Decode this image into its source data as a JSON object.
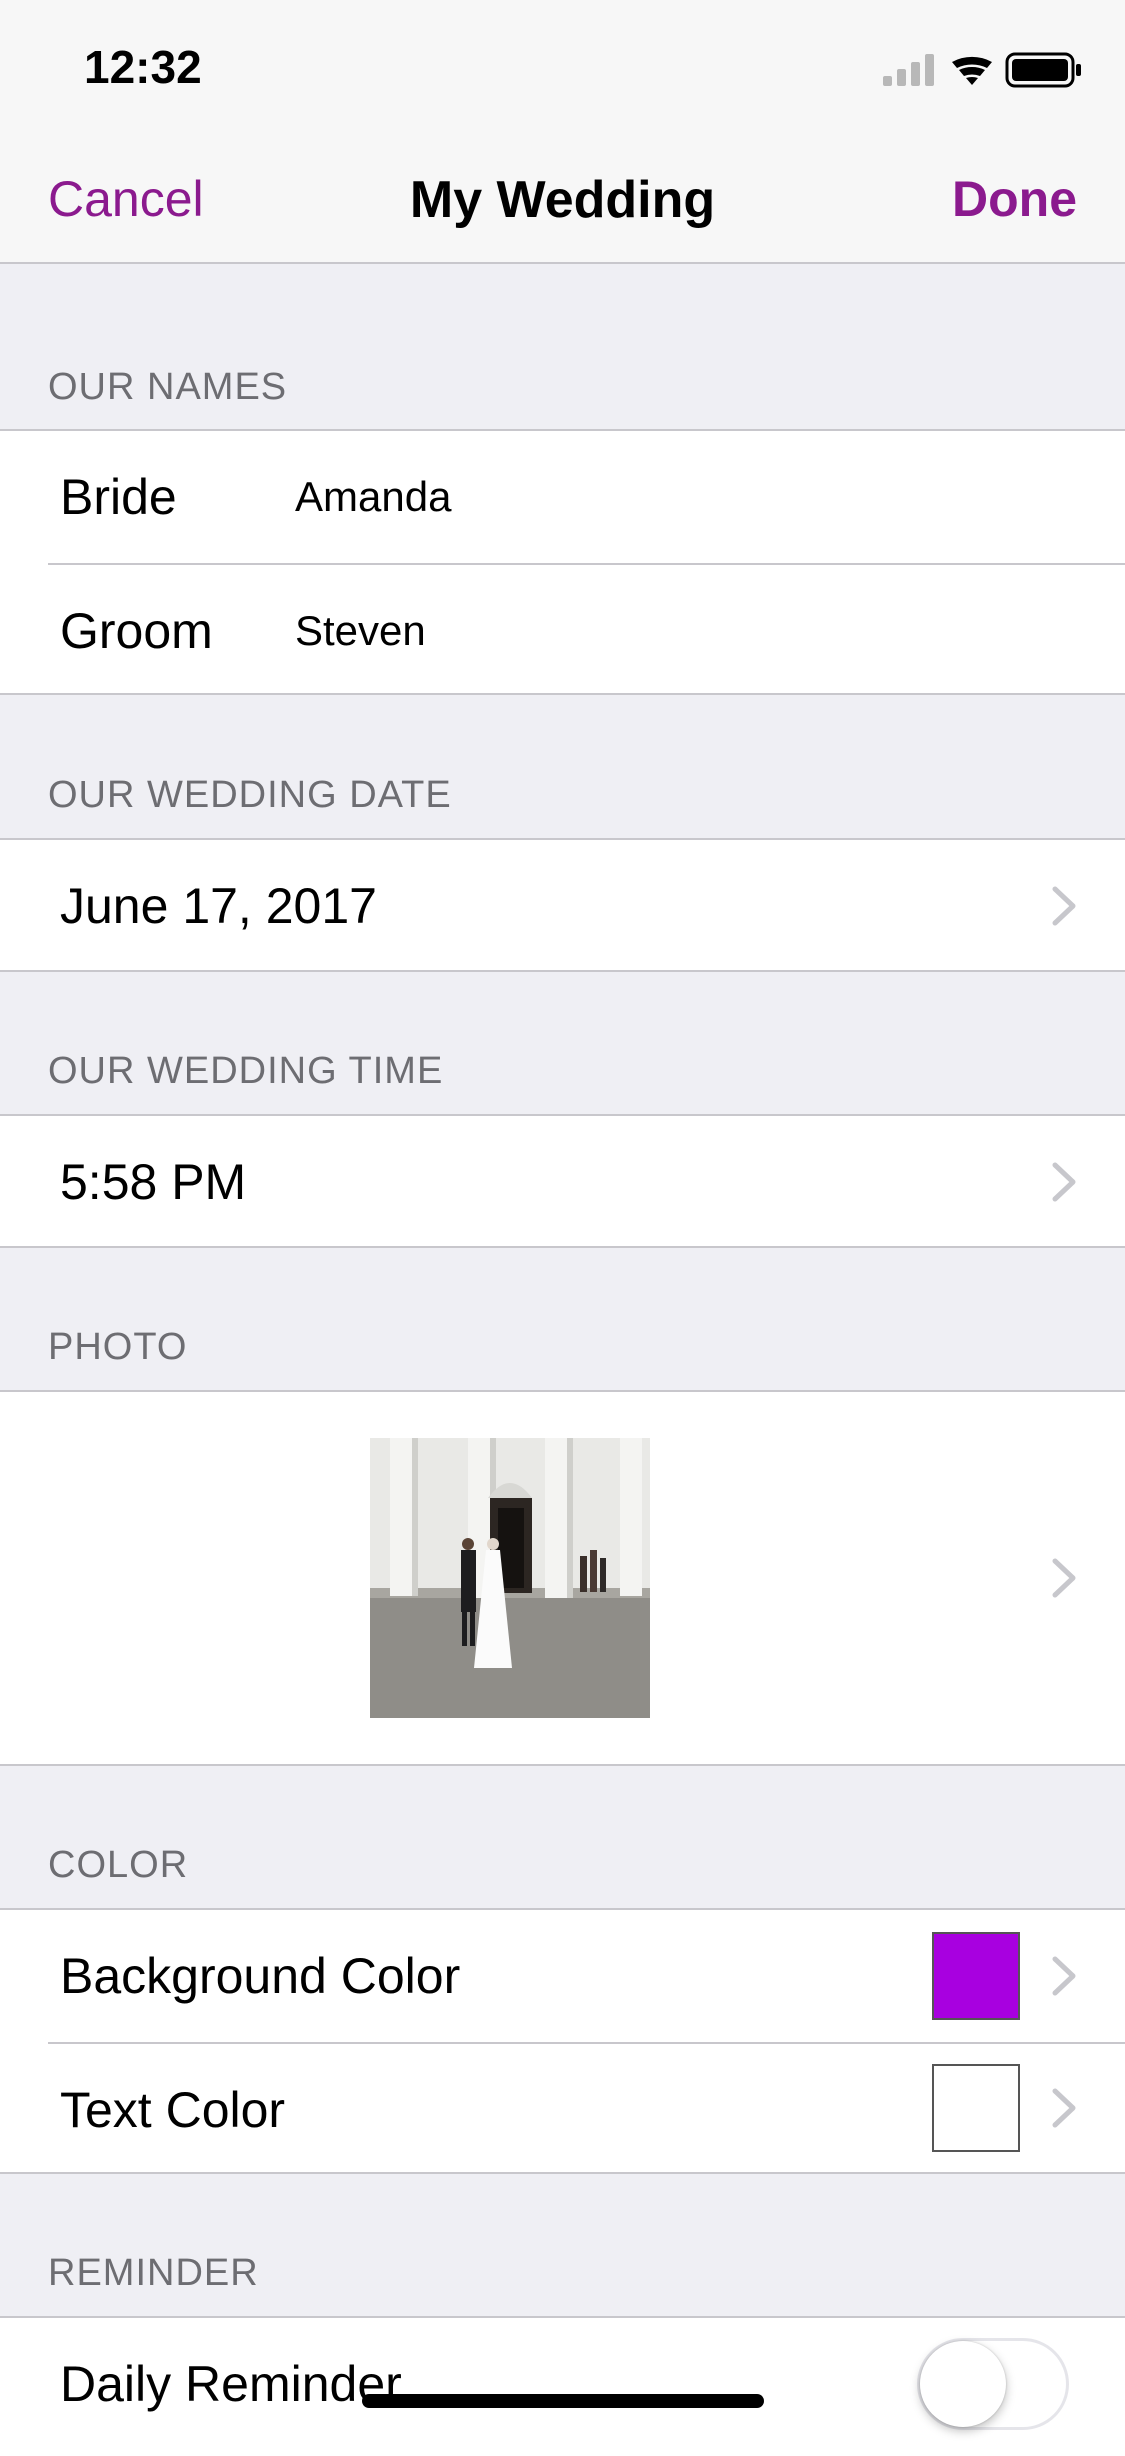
{
  "status_bar": {
    "time": "12:32"
  },
  "nav": {
    "cancel_label": "Cancel",
    "title": "My Wedding",
    "done_label": "Done"
  },
  "names": {
    "header": "OUR NAMES",
    "bride_label": "Bride",
    "bride_value": "Amanda",
    "groom_label": "Groom",
    "groom_value": "Steven"
  },
  "date": {
    "header": "OUR WEDDING DATE",
    "value": "June 17, 2017"
  },
  "time": {
    "header": "OUR WEDDING TIME",
    "value": "5:58 PM"
  },
  "photo": {
    "header": "PHOTO"
  },
  "color": {
    "header": "COLOR",
    "background_label": "Background Color",
    "background_color": "#a800e0",
    "text_label": "Text Color",
    "text_color": "#ffffff"
  },
  "reminder": {
    "header": "REMINDER",
    "daily_label": "Daily Reminder",
    "daily_on": false
  },
  "theme": {
    "accent": "#8b1a8e"
  }
}
